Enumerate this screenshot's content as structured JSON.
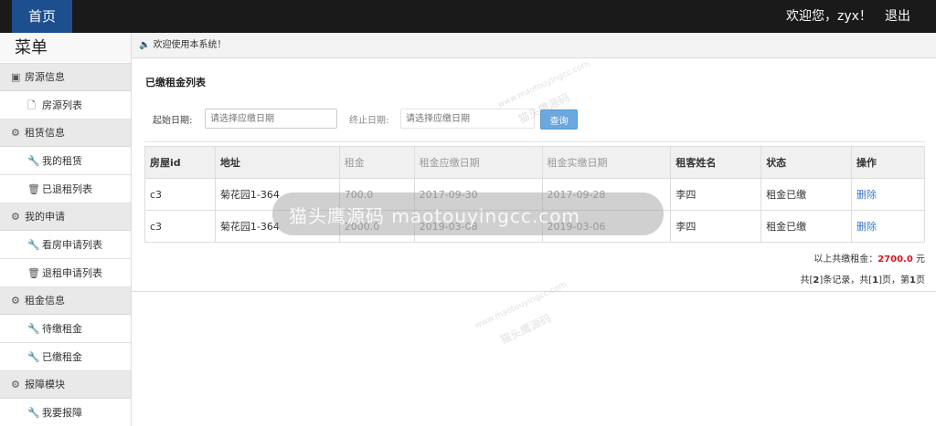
{
  "topbar": {
    "home_label": "首页",
    "welcome": "欢迎您，zyx！",
    "logout": "退出"
  },
  "sidebar": {
    "title": "菜单",
    "groups": [
      {
        "label": "房源信息",
        "items": [
          {
            "label": "房源列表"
          }
        ]
      },
      {
        "label": "租赁信息",
        "items": [
          {
            "label": "我的租赁"
          },
          {
            "label": "已退租列表"
          }
        ]
      },
      {
        "label": "我的申请",
        "items": [
          {
            "label": "看房申请列表"
          },
          {
            "label": "退租申请列表"
          }
        ]
      },
      {
        "label": "租金信息",
        "items": [
          {
            "label": "待缴租金"
          },
          {
            "label": "已缴租金"
          }
        ]
      },
      {
        "label": "报障模块",
        "items": [
          {
            "label": "我要报障"
          }
        ]
      }
    ]
  },
  "notice": "欢迎使用本系统！",
  "main": {
    "title": "已缴租金列表",
    "search": {
      "start_label": "起始日期:",
      "start_placeholder": "请选择应缴日期",
      "end_label": "终止日期:",
      "end_placeholder": "请选择应缴日期",
      "button": "查询"
    },
    "table": {
      "headers": [
        "房屋id",
        "地址",
        "租金",
        "租金应缴日期",
        "租金实缴日期",
        "租客姓名",
        "状态",
        "操作"
      ],
      "rows": [
        [
          "c3",
          "菊花园1-364",
          "700.0",
          "2017-09-30",
          "2017-09-28",
          "李四",
          "租金已缴",
          "删除"
        ],
        [
          "c3",
          "菊花园1-364",
          "2000.0",
          "2019-03-08",
          "2019-03-06",
          "李四",
          "租金已缴",
          "删除"
        ]
      ]
    },
    "total_prefix": "以上共缴租金：",
    "total_amount": "2700.0",
    "total_suffix": " 元",
    "pager": {
      "p1": "共[",
      "records": "2",
      "p2": "]条记录，共[",
      "pages": "1",
      "p3": "]页，第",
      "current": "1",
      "p4": "页"
    }
  },
  "watermark": {
    "banner": "猫头鹰源码 maotouyingcc.com",
    "small_cn": "猫头鹰源码",
    "small_en": "www.maotouyingcc.com"
  }
}
